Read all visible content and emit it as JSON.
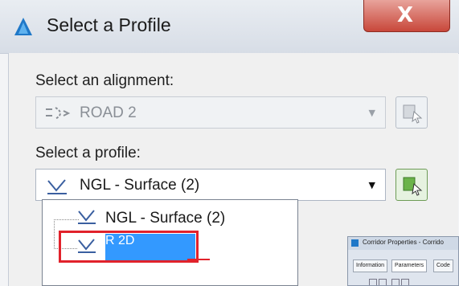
{
  "dialog": {
    "title": "Select a Profile",
    "close_glyph": "X"
  },
  "alignment": {
    "label": "Select an alignment:",
    "value": "ROAD 2",
    "icon": "alignment-icon"
  },
  "profile": {
    "label": "Select a profile:",
    "value": "NGL - Surface (2)",
    "icon": "profile-icon",
    "options": [
      {
        "label": "NGL - Surface (2)",
        "selected": false
      },
      {
        "label": "R 2D",
        "selected": true
      }
    ]
  },
  "background_window": {
    "title": "Corridor Properties - Corrido",
    "tabs": [
      "Information",
      "Parameters",
      "Code"
    ]
  },
  "colors": {
    "highlight": "#3399ff",
    "annotation_red": "#e1222b",
    "close_red": "#c8473a"
  }
}
